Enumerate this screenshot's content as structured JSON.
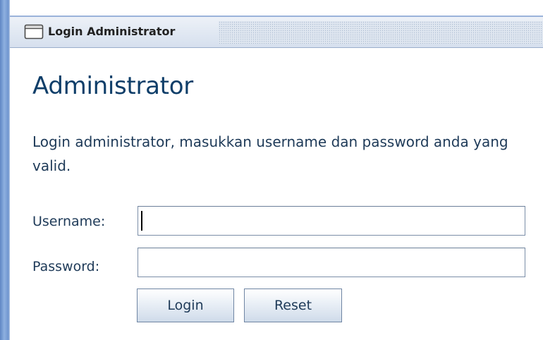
{
  "window": {
    "title": "Login Administrator",
    "icon": "window-icon"
  },
  "page": {
    "heading": "Administrator",
    "description": "Login administrator, masukkan username dan password anda yang valid."
  },
  "form": {
    "username_label": "Username:",
    "username_value": "",
    "password_label": "Password:",
    "password_value": "",
    "login_label": "Login",
    "reset_label": "Reset"
  },
  "colors": {
    "heading": "#0f3e69",
    "text": "#1e3a58",
    "window_border": "#6f95cf"
  }
}
